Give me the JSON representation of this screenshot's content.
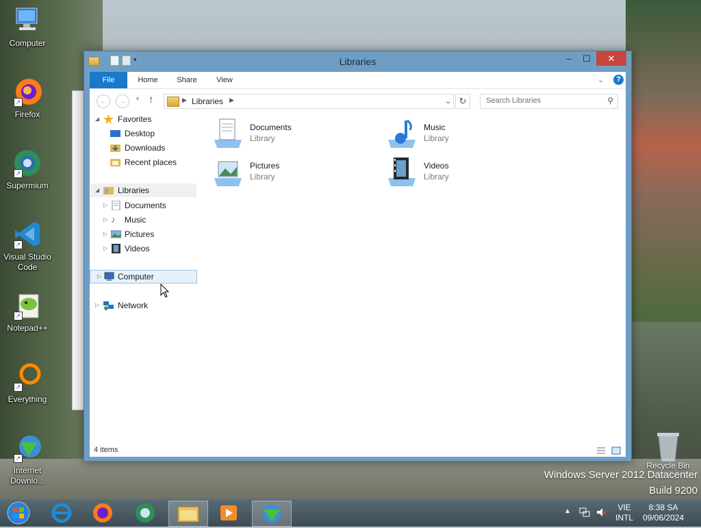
{
  "desktop": {
    "icons": [
      {
        "label": "Computer"
      },
      {
        "label": "Firefox"
      },
      {
        "label": "Supermium"
      },
      {
        "label": "Visual Studio\nCode"
      },
      {
        "label": "Notepad++"
      },
      {
        "label": "Everything"
      },
      {
        "label": "Internet\nDownlo..."
      }
    ],
    "recycle_bin": "Recycle Bin",
    "watermark_line1": "Windows Server 2012 Datacenter",
    "watermark_line2": "Build 9200"
  },
  "window": {
    "title": "Libraries",
    "controls": {
      "minimize": "–",
      "maximize": "☐",
      "close": "✕"
    },
    "ribbon": {
      "tabs": [
        "File",
        "Home",
        "Share",
        "View"
      ],
      "help": "?"
    },
    "address": {
      "path": "Libraries",
      "search_placeholder": "Search Libraries"
    },
    "tree": {
      "favorites": "Favorites",
      "favorites_items": [
        "Desktop",
        "Downloads",
        "Recent places"
      ],
      "libraries": "Libraries",
      "libraries_items": [
        "Documents",
        "Music",
        "Pictures",
        "Videos"
      ],
      "computer": "Computer",
      "network": "Network"
    },
    "content": [
      {
        "name": "Documents",
        "type": "Library"
      },
      {
        "name": "Music",
        "type": "Library"
      },
      {
        "name": "Pictures",
        "type": "Library"
      },
      {
        "name": "Videos",
        "type": "Library"
      }
    ],
    "status": "4 items"
  },
  "taskbar": {
    "language": "VIE",
    "layout": "INTL",
    "time": "8:38 SA",
    "date": "09/06/2024"
  },
  "colors": {
    "accent": "#1979ca",
    "close": "#c7463c",
    "frame": "#6f9ec4"
  }
}
